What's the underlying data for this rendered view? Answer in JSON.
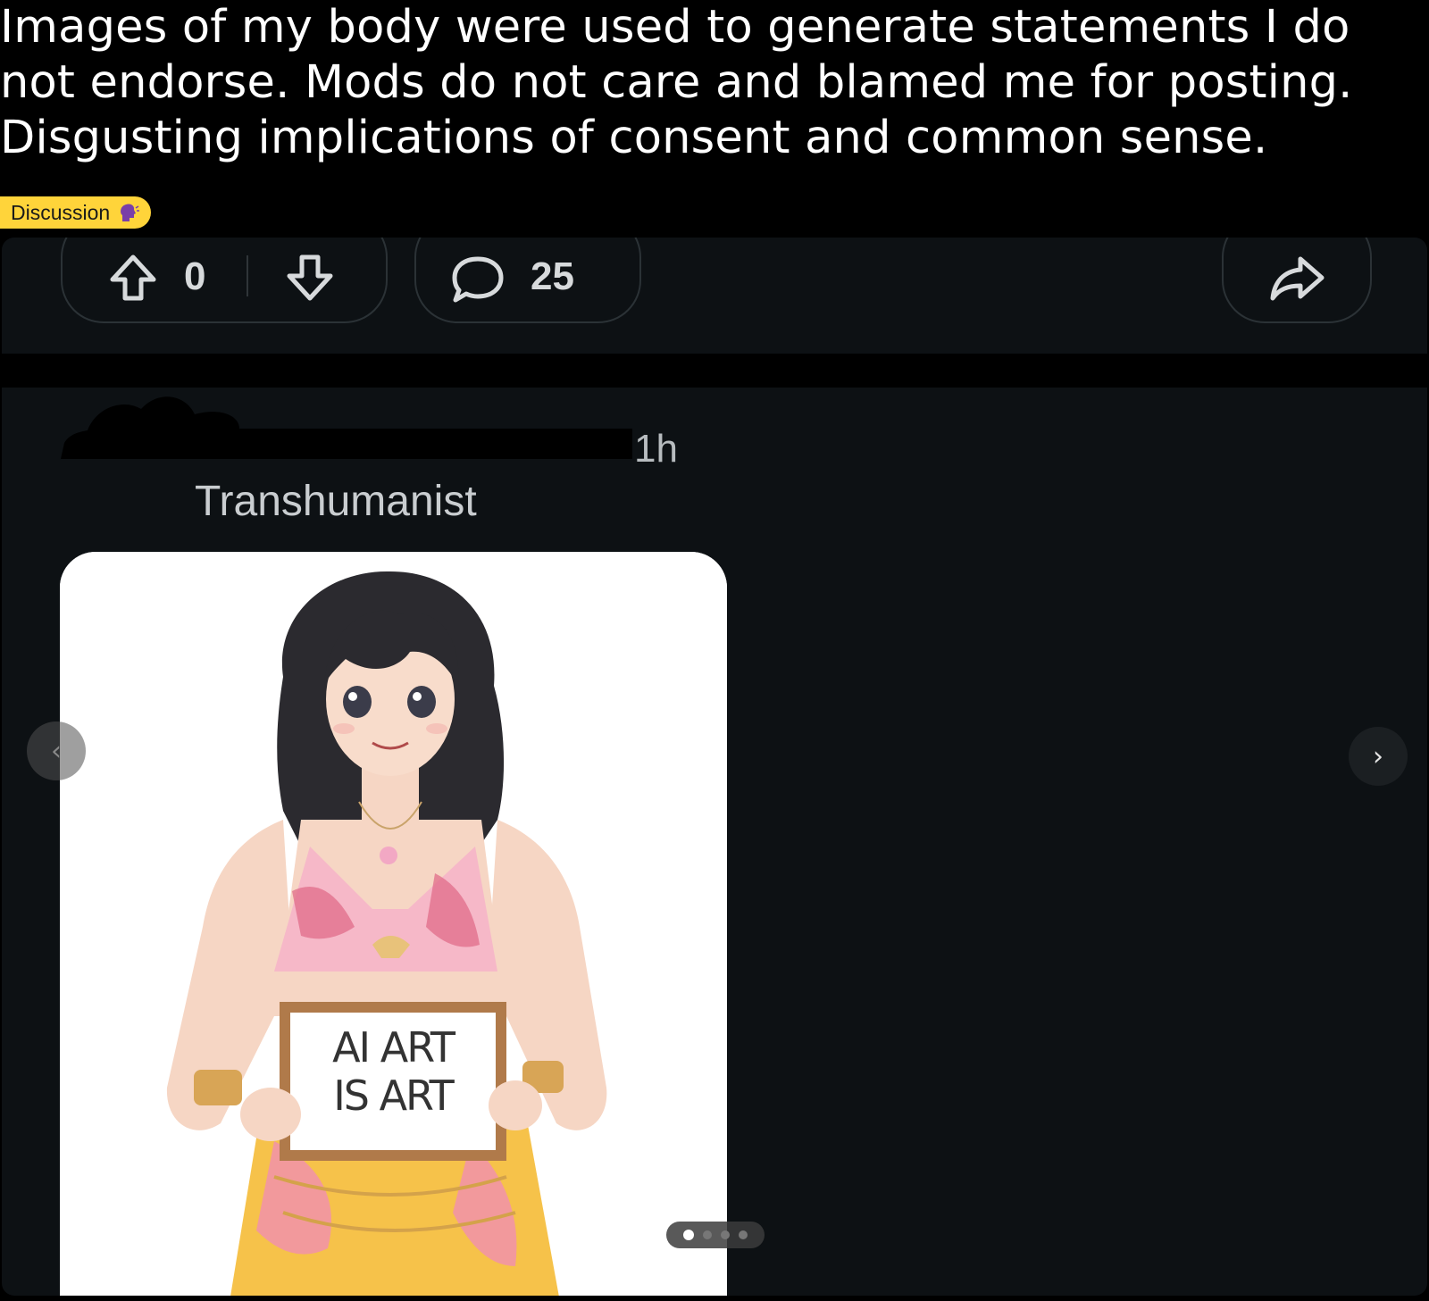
{
  "post": {
    "title": "Images of my body were used to generate statements I do not endorse. Mods do not care and blamed me for posting. Disgusting implications of consent and common sense.",
    "flair": {
      "label": "Discussion",
      "color": "#ffd43a",
      "emoji": "speaking-head-icon"
    }
  },
  "actions": {
    "vote_count": "0",
    "comment_count": "25",
    "icons": [
      "upvote-icon",
      "downvote-icon",
      "comment-icon",
      "share-icon"
    ]
  },
  "comment": {
    "age": "1h",
    "community": "Transhumanist",
    "image": {
      "sign_line1": "AI ART",
      "sign_line2": "IS ART",
      "carousel_total": 4,
      "carousel_current": 1
    }
  },
  "colors": {
    "page_bg": "#000000",
    "card_bg": "#0d1114",
    "pill_border": "#2b3236",
    "text_secondary": "#b7bcbf"
  }
}
